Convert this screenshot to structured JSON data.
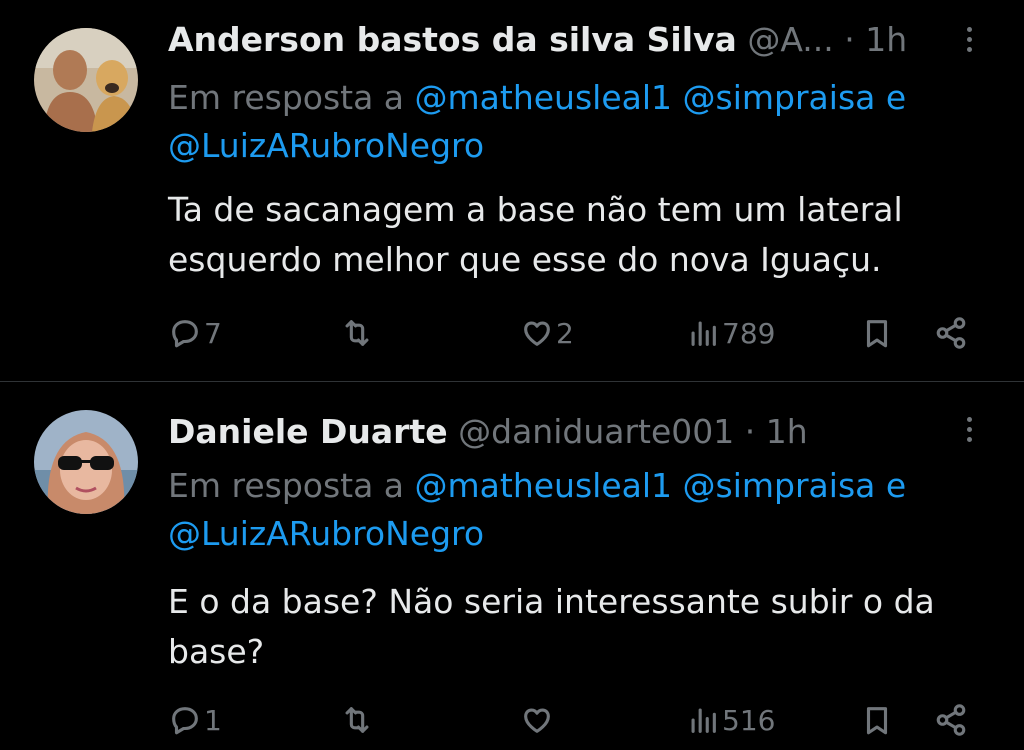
{
  "tweets": [
    {
      "name": "Anderson bastos da silva Silva",
      "handle": "@A...",
      "dot": " · ",
      "time": "1h",
      "reply_prefix": "Em resposta a ",
      "mention1": "@matheusleal1",
      "mention2": "@simpraisa",
      "conj": " e",
      "mention3": "@LuizARubroNegro",
      "text": "Ta de sacanagem a base não tem um lateral esquerdo melhor que esse do nova Iguaçu.",
      "replies": "7",
      "reposts": "",
      "likes": "2",
      "views": "789",
      "avatar_desc": "avatar-man-with-dog"
    },
    {
      "name": "Daniele Duarte",
      "handle": "@daniduarte001",
      "dot": " · ",
      "time": "1h",
      "reply_prefix": "Em resposta a ",
      "mention1": "@matheusleal1",
      "mention2": "@simpraisa",
      "conj": " e",
      "mention3": "@LuizARubroNegro",
      "text": "E o da base? Não seria interessante subir o da base?",
      "replies": "1",
      "reposts": "",
      "likes": "",
      "views": "516",
      "avatar_desc": "avatar-woman-sunglasses"
    }
  ],
  "icons": [
    "reply-icon",
    "repost-icon",
    "like-icon",
    "views-icon",
    "bookmark-icon",
    "share-icon",
    "more-icon"
  ],
  "colors": {
    "background": "#000000",
    "text": "#e7e9ea",
    "muted": "#71767b",
    "link": "#1d9bf0",
    "divider": "#2f3336"
  }
}
